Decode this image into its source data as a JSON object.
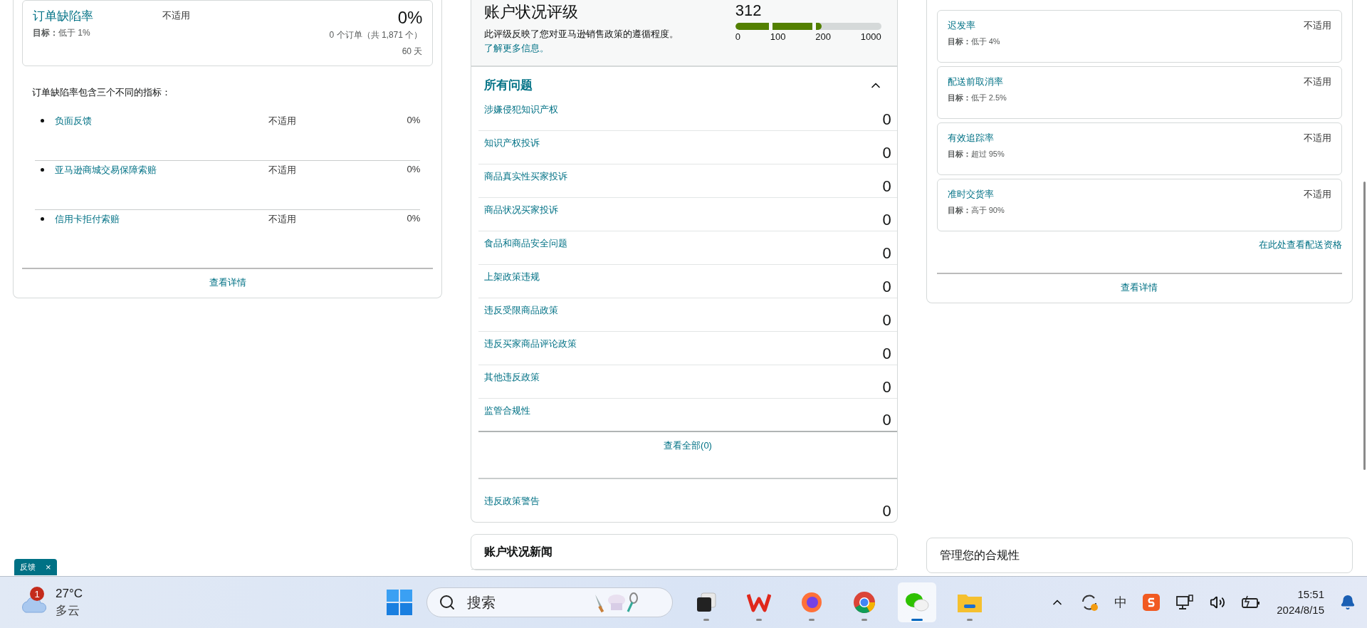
{
  "order_defect": {
    "metric": {
      "name": "订单缺陷率",
      "target": "**目标：**低于 1%",
      "status": "不适用",
      "value": "0%",
      "detail": "0 个订单（共 1,871 个）",
      "period": "60 天"
    },
    "intro": "订单缺陷率包含三个不同的指标：",
    "sub_metrics": [
      {
        "name": "负面反馈",
        "status": "不适用",
        "value": "0%"
      },
      {
        "name": "亚马逊商城交易保障索赔",
        "status": "不适用",
        "value": "0%"
      },
      {
        "name": "信用卡拒付索赔",
        "status": "不适用",
        "value": "0%"
      }
    ],
    "details_link": "查看详情"
  },
  "account_health": {
    "rating": {
      "title": "账户状况评级",
      "description": "此评级反映了您对亚马逊销售政策的遵循程度。",
      "link": "了解更多信息。",
      "score": "312",
      "level": 0.59,
      "scale_labels": [
        "0",
        "100",
        "200",
        "1000"
      ]
    },
    "issues": {
      "title": "所有问题",
      "expanded": true,
      "items": [
        {
          "name": "涉嫌侵犯知识产权",
          "count": "0"
        },
        {
          "name": "知识产权投诉",
          "count": "0"
        },
        {
          "name": "商品真实性买家投诉",
          "count": "0"
        },
        {
          "name": "商品状况买家投诉",
          "count": "0"
        },
        {
          "name": "食品和商品安全问题",
          "count": "0"
        },
        {
          "name": "上架政策违规",
          "count": "0"
        },
        {
          "name": "违反受限商品政策",
          "count": "0"
        },
        {
          "name": "违反买家商品评论政策",
          "count": "0"
        },
        {
          "name": "其他违反政策",
          "count": "0"
        },
        {
          "name": "监管合规性",
          "count": "0"
        }
      ],
      "view_all": "查看全部(0)"
    },
    "warnings": {
      "name": "违反政策警告",
      "count": "0"
    }
  },
  "news": {
    "title": "账户状况新闻"
  },
  "shipping": {
    "metrics": [
      {
        "name": "迟发率",
        "target": "**目标：**低于 4%",
        "status": "不适用"
      },
      {
        "name": "配送前取消率",
        "target": "**目标：**低于 2.5%",
        "status": "不适用"
      },
      {
        "name": "有效追踪率",
        "target": "**目标：**超过 95%",
        "status": "不适用"
      },
      {
        "name": "准时交货率",
        "target": "**目标：**高于 90%",
        "status": "不适用"
      }
    ],
    "eligibility_link": "在此处查看配送资格",
    "details_link": "查看详情"
  },
  "compliance": {
    "title": "管理您的合规性"
  },
  "feedback_tab": {
    "label": "反馈",
    "close": "×"
  },
  "taskbar": {
    "weather": {
      "badge": "1",
      "temperature": "27°C",
      "condition": "多云"
    },
    "search": {
      "placeholder": "搜索"
    },
    "apps": [
      {
        "kind": "task-view",
        "selected": false,
        "running": true
      },
      {
        "kind": "wps",
        "selected": false,
        "running": true
      },
      {
        "kind": "firefox",
        "selected": false,
        "running": true
      },
      {
        "kind": "chrome",
        "selected": false,
        "running": true
      },
      {
        "kind": "wechat",
        "selected": true,
        "running": true
      },
      {
        "kind": "files",
        "selected": false,
        "running": true
      }
    ],
    "tray": {
      "ime": "中"
    },
    "clock": {
      "time": "15:51",
      "date": "2024/8/15"
    }
  }
}
